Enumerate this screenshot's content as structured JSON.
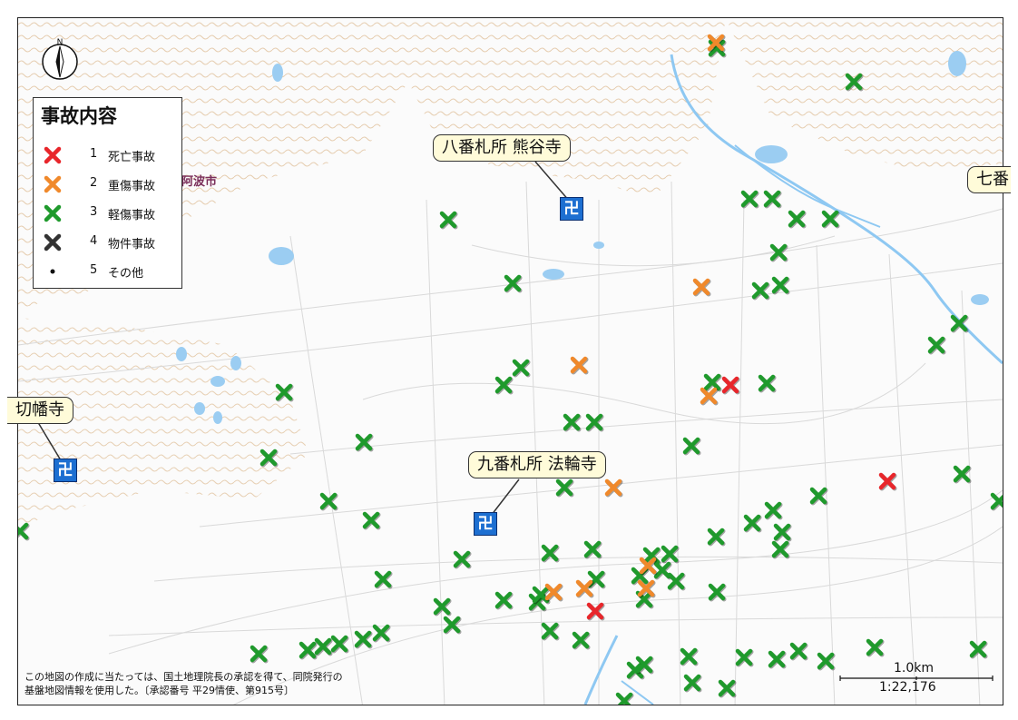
{
  "legend": {
    "title": "事故内容",
    "items": [
      {
        "num": "1",
        "label": "死亡事故",
        "color": "#e8262b",
        "symbol": "x-mark"
      },
      {
        "num": "2",
        "label": "重傷事故",
        "color": "#f0892b",
        "symbol": "x-mark"
      },
      {
        "num": "3",
        "label": "軽傷事故",
        "color": "#1f9a2c",
        "symbol": "x-mark"
      },
      {
        "num": "4",
        "label": "物件事故",
        "color": "#333333",
        "symbol": "x-mark"
      },
      {
        "num": "5",
        "label": "その他",
        "color": "#111111",
        "symbol": "dot"
      }
    ]
  },
  "callouts": {
    "kumadaniji": "八番札所 熊谷寺",
    "horinji": "九番札所 法輪寺",
    "kirihataji": "切幡寺",
    "shichiban": "七番"
  },
  "city_label": "阿波市",
  "north_label": "N",
  "temple_symbol": "卍",
  "copyright": {
    "line1": "この地図の作成に当たっては、国土地理院長の承認を得て、同院発行の",
    "line2": "基盤地図情報を使用した。〔承認番号 平29情使、第915号〕"
  },
  "scale": {
    "distance": "1.0km",
    "ratio": "1:22,176"
  },
  "incidents": {
    "fatal": [
      [
        805,
        424
      ],
      [
        978,
        530
      ],
      [
        656,
        673
      ]
    ],
    "serious": [
      [
        789,
        47
      ],
      [
        773,
        316
      ],
      [
        638,
        402
      ],
      [
        781,
        436
      ],
      [
        676,
        537
      ],
      [
        714,
        623
      ],
      [
        712,
        648
      ],
      [
        644,
        648
      ],
      [
        610,
        652
      ]
    ],
    "minor": [
      [
        790,
        53
      ],
      [
        941,
        90
      ],
      [
        494,
        242
      ],
      [
        826,
        219
      ],
      [
        851,
        219
      ],
      [
        878,
        241
      ],
      [
        915,
        241
      ],
      [
        858,
        278
      ],
      [
        565,
        312
      ],
      [
        838,
        320
      ],
      [
        860,
        314
      ],
      [
        1057,
        356
      ],
      [
        1032,
        380
      ],
      [
        574,
        405
      ],
      [
        555,
        424
      ],
      [
        785,
        421
      ],
      [
        845,
        422
      ],
      [
        313,
        432
      ],
      [
        630,
        465
      ],
      [
        655,
        465
      ],
      [
        401,
        487
      ],
      [
        762,
        491
      ],
      [
        296,
        504
      ],
      [
        622,
        537
      ],
      [
        1060,
        522
      ],
      [
        902,
        546
      ],
      [
        362,
        552
      ],
      [
        409,
        573
      ],
      [
        852,
        562
      ],
      [
        829,
        576
      ],
      [
        862,
        586
      ],
      [
        789,
        591
      ],
      [
        860,
        605
      ],
      [
        1101,
        552
      ],
      [
        509,
        616
      ],
      [
        606,
        609
      ],
      [
        653,
        605
      ],
      [
        718,
        612
      ],
      [
        738,
        610
      ],
      [
        422,
        638
      ],
      [
        657,
        638
      ],
      [
        705,
        634
      ],
      [
        730,
        628
      ],
      [
        745,
        640
      ],
      [
        710,
        660
      ],
      [
        790,
        652
      ],
      [
        487,
        668
      ],
      [
        555,
        661
      ],
      [
        592,
        663
      ],
      [
        596,
        655
      ],
      [
        498,
        688
      ],
      [
        606,
        695
      ],
      [
        640,
        705
      ],
      [
        420,
        697
      ],
      [
        400,
        704
      ],
      [
        374,
        709
      ],
      [
        356,
        712
      ],
      [
        339,
        716
      ],
      [
        285,
        720
      ],
      [
        759,
        723
      ],
      [
        820,
        724
      ],
      [
        856,
        726
      ],
      [
        880,
        717
      ],
      [
        910,
        728
      ],
      [
        964,
        713
      ],
      [
        1078,
        715
      ],
      [
        700,
        738
      ],
      [
        710,
        732
      ],
      [
        763,
        752
      ],
      [
        801,
        758
      ],
      [
        688,
        772
      ],
      [
        22,
        585
      ]
    ]
  }
}
